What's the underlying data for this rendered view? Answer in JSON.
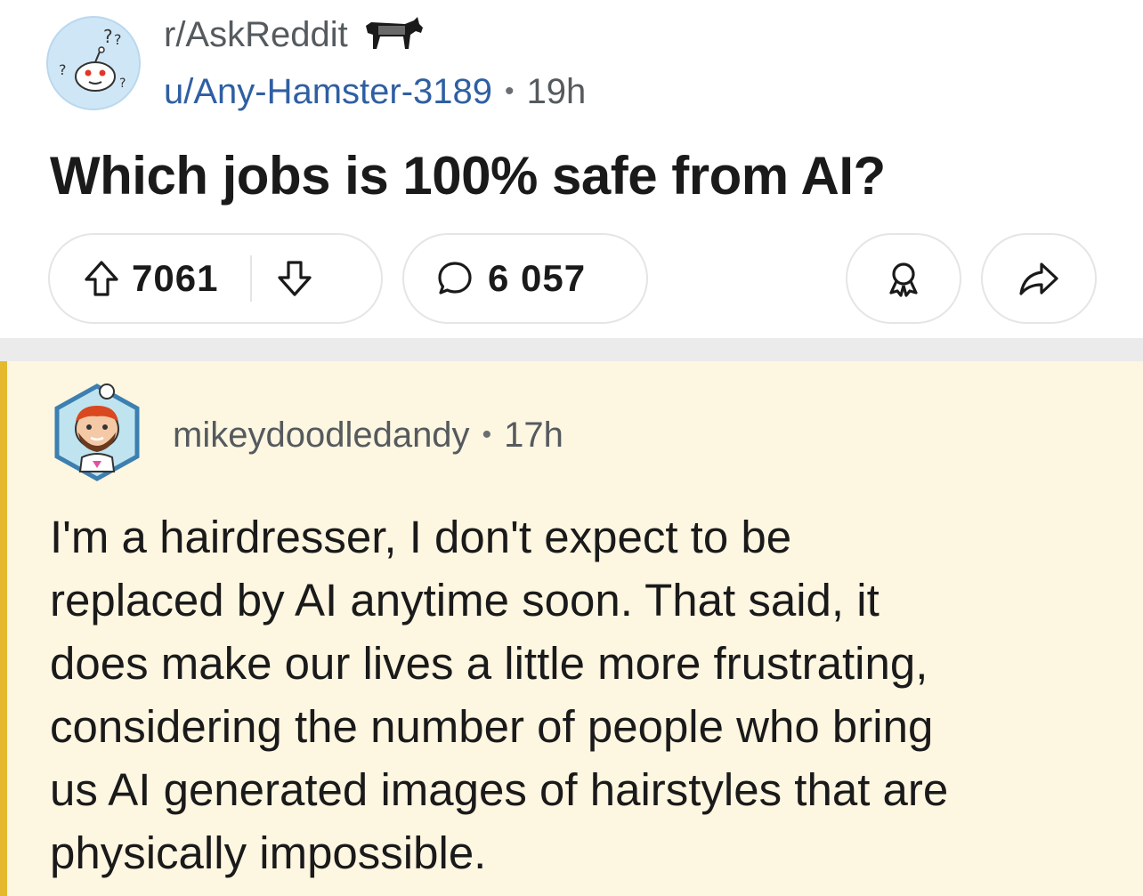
{
  "post": {
    "subreddit": "r/AskReddit",
    "author": "u/Any-Hamster-3189",
    "separator": "•",
    "age": "19h",
    "title": "Which jobs is 100% safe from AI?",
    "upvotes": "7061",
    "comments": "6 057",
    "subreddit_icon": "reddit-snoo-question-icon",
    "flair_icon": "donkey-icon"
  },
  "comment": {
    "author": "mikeydoodledandy",
    "separator": "•",
    "age": "17h",
    "avatar_icon": "bearded-snoo-avatar",
    "lines": [
      "I'm a hairdresser, I don't expect to be",
      "replaced by AI anytime soon. That said, it",
      "does make our lives a little more frustrating,",
      "considering the number of people who bring",
      "us AI generated images of hairstyles that are",
      "physically impossible."
    ]
  },
  "colors": {
    "comment_highlight_bg": "#fdf6e0",
    "comment_highlight_bar": "#e5b92e",
    "author_link": "#2f5fa3",
    "separator": "#ebebeb"
  }
}
